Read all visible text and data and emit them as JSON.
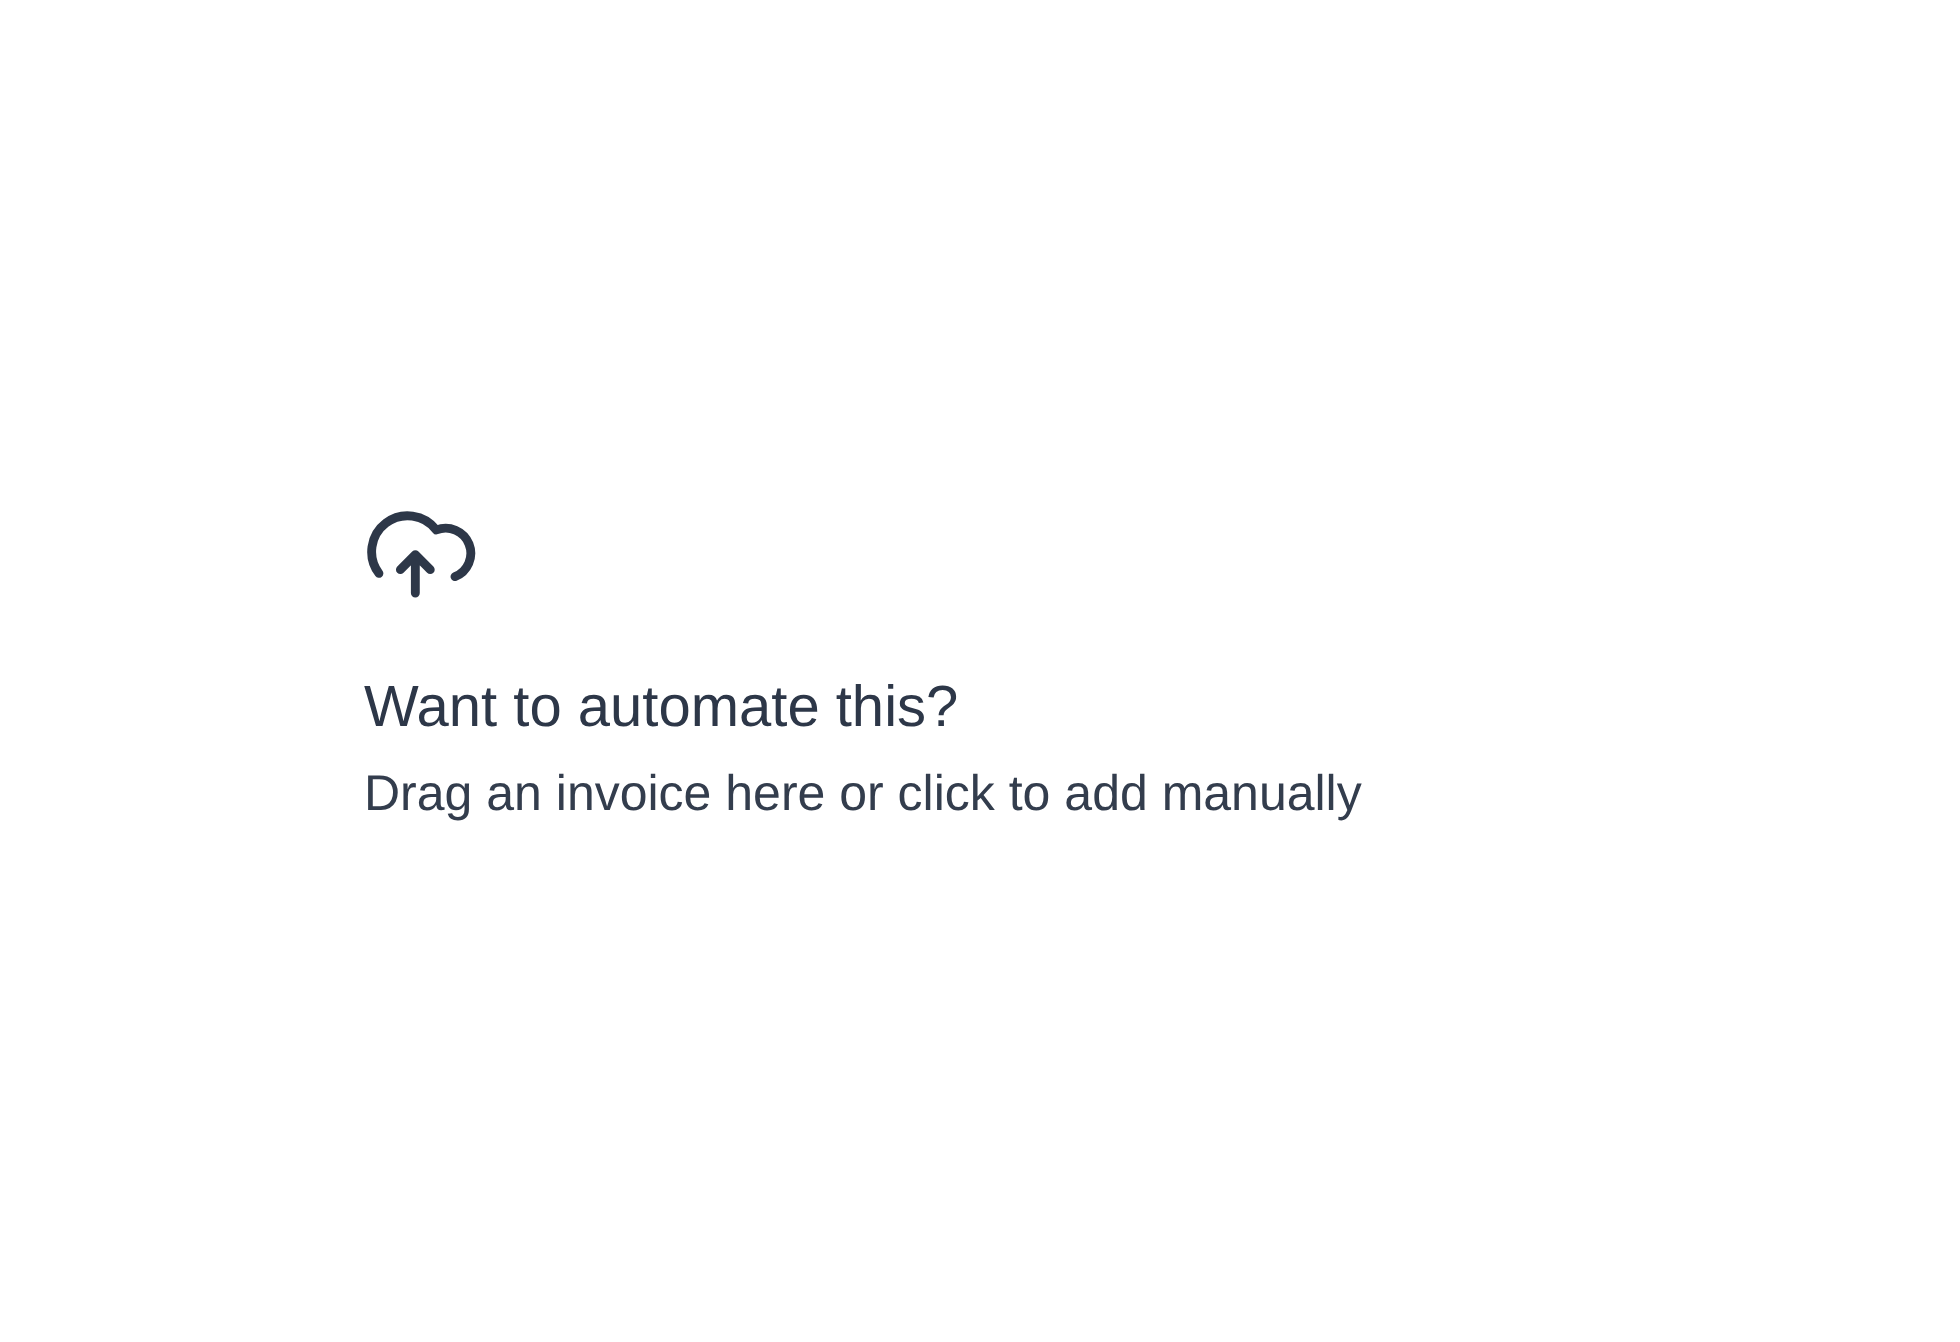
{
  "dropzone": {
    "title": "Want to automate this?",
    "hint": "Drag an invoice here or click to add manually"
  }
}
